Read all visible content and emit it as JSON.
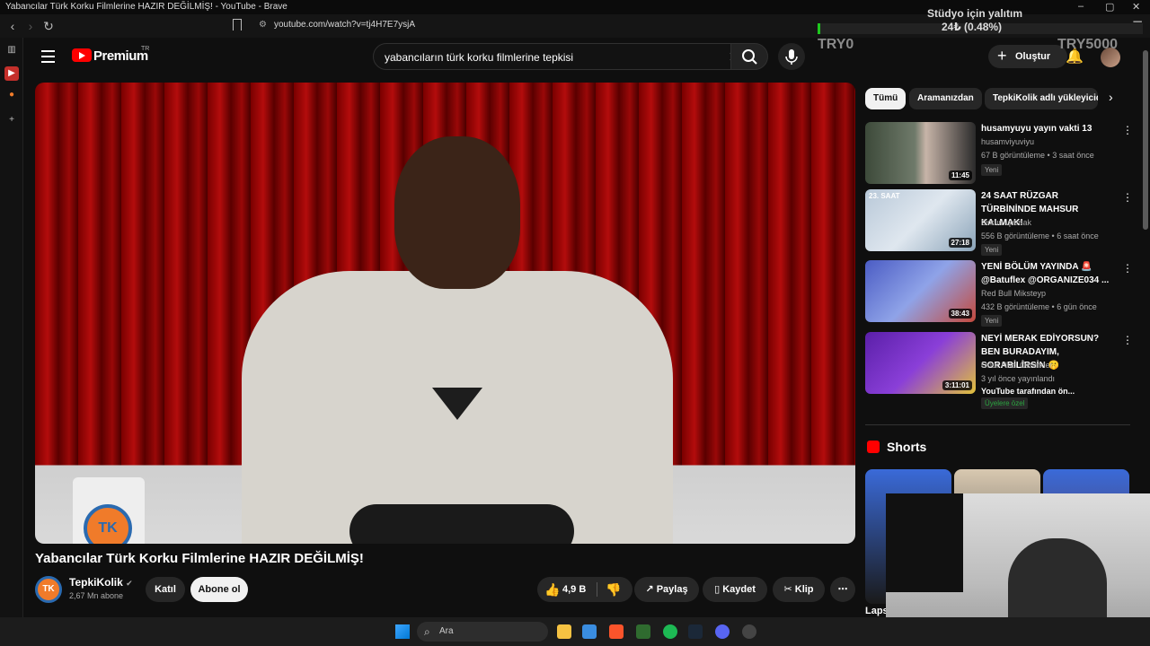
{
  "window": {
    "title": "Yabancılar Türk Korku Filmlerine HAZIR DEĞİLMİŞ! - YouTube - Brave",
    "url": "youtube.com/watch?v=tj4H7E7ysjA"
  },
  "stream_overlay": {
    "label_line1": "Stüdyo için yalıtım",
    "label_line2": "24₺ (0.48%)",
    "goal_start": "TRY0",
    "goal_end": "TRY5000",
    "progress": 0.0048
  },
  "header": {
    "brand": "Premium",
    "country": "TR",
    "search_value": "yabancıların türk korku filmlerine tepkisi",
    "create_label": "Oluştur"
  },
  "video": {
    "mug_logo": "TK",
    "title": "Yabancılar Türk Korku Filmlerine HAZIR DEĞİLMİŞ!",
    "channel_avatar": "TK",
    "channel_name": "TepkiKolik",
    "subscribers": "2,67 Mn abone",
    "join_label": "Katıl",
    "subscribe_label": "Abone ol",
    "likes": "4,9 B",
    "share_label": "Paylaş",
    "save_label": "Kaydet",
    "clip_label": "Klip"
  },
  "chips": [
    "Tümü",
    "Aramanızdan",
    "TepkiKolik adlı yükleyiciden"
  ],
  "recommendations": [
    {
      "title": "husamyuyu yayın vakti 13",
      "channel": "husamviyuviyu",
      "meta": "67 B görüntüleme • 3 saat önce",
      "badge": "Yeni",
      "duration": "11:45"
    },
    {
      "title": "24 SAAT RÜZGAR TÜRBİNİNDE MAHSUR KALMAK!",
      "channel": "Orkun Işıtmak",
      "meta": "556 B görüntüleme • 6 saat önce",
      "badge": "Yeni",
      "duration": "27:18",
      "thumb_label": "23. SAAT"
    },
    {
      "title": "YENİ BÖLÜM YAYINDA 🚨 @Batuflex @ORGANIZE034 ...",
      "channel": "Red Bull Miksteyp",
      "meta": "432 B görüntüleme • 6 gün önce",
      "badge": "Yeni",
      "duration": "38:43"
    },
    {
      "title": "NEYİ MERAK EDİYORSUN? BEN BURADAYIM, SORABİLİRSİN 🤫",
      "channel": "Onur Naci Öztürkler",
      "meta": "3 yıl önce yayınlandı",
      "extra": "YouTube tarafından ön...",
      "badge": "Üyelere özel",
      "duration": "3:11:01"
    }
  ],
  "shorts": {
    "title": "Shorts",
    "next_label": "Laps"
  },
  "taskbar": {
    "search_placeholder": "Ara"
  }
}
